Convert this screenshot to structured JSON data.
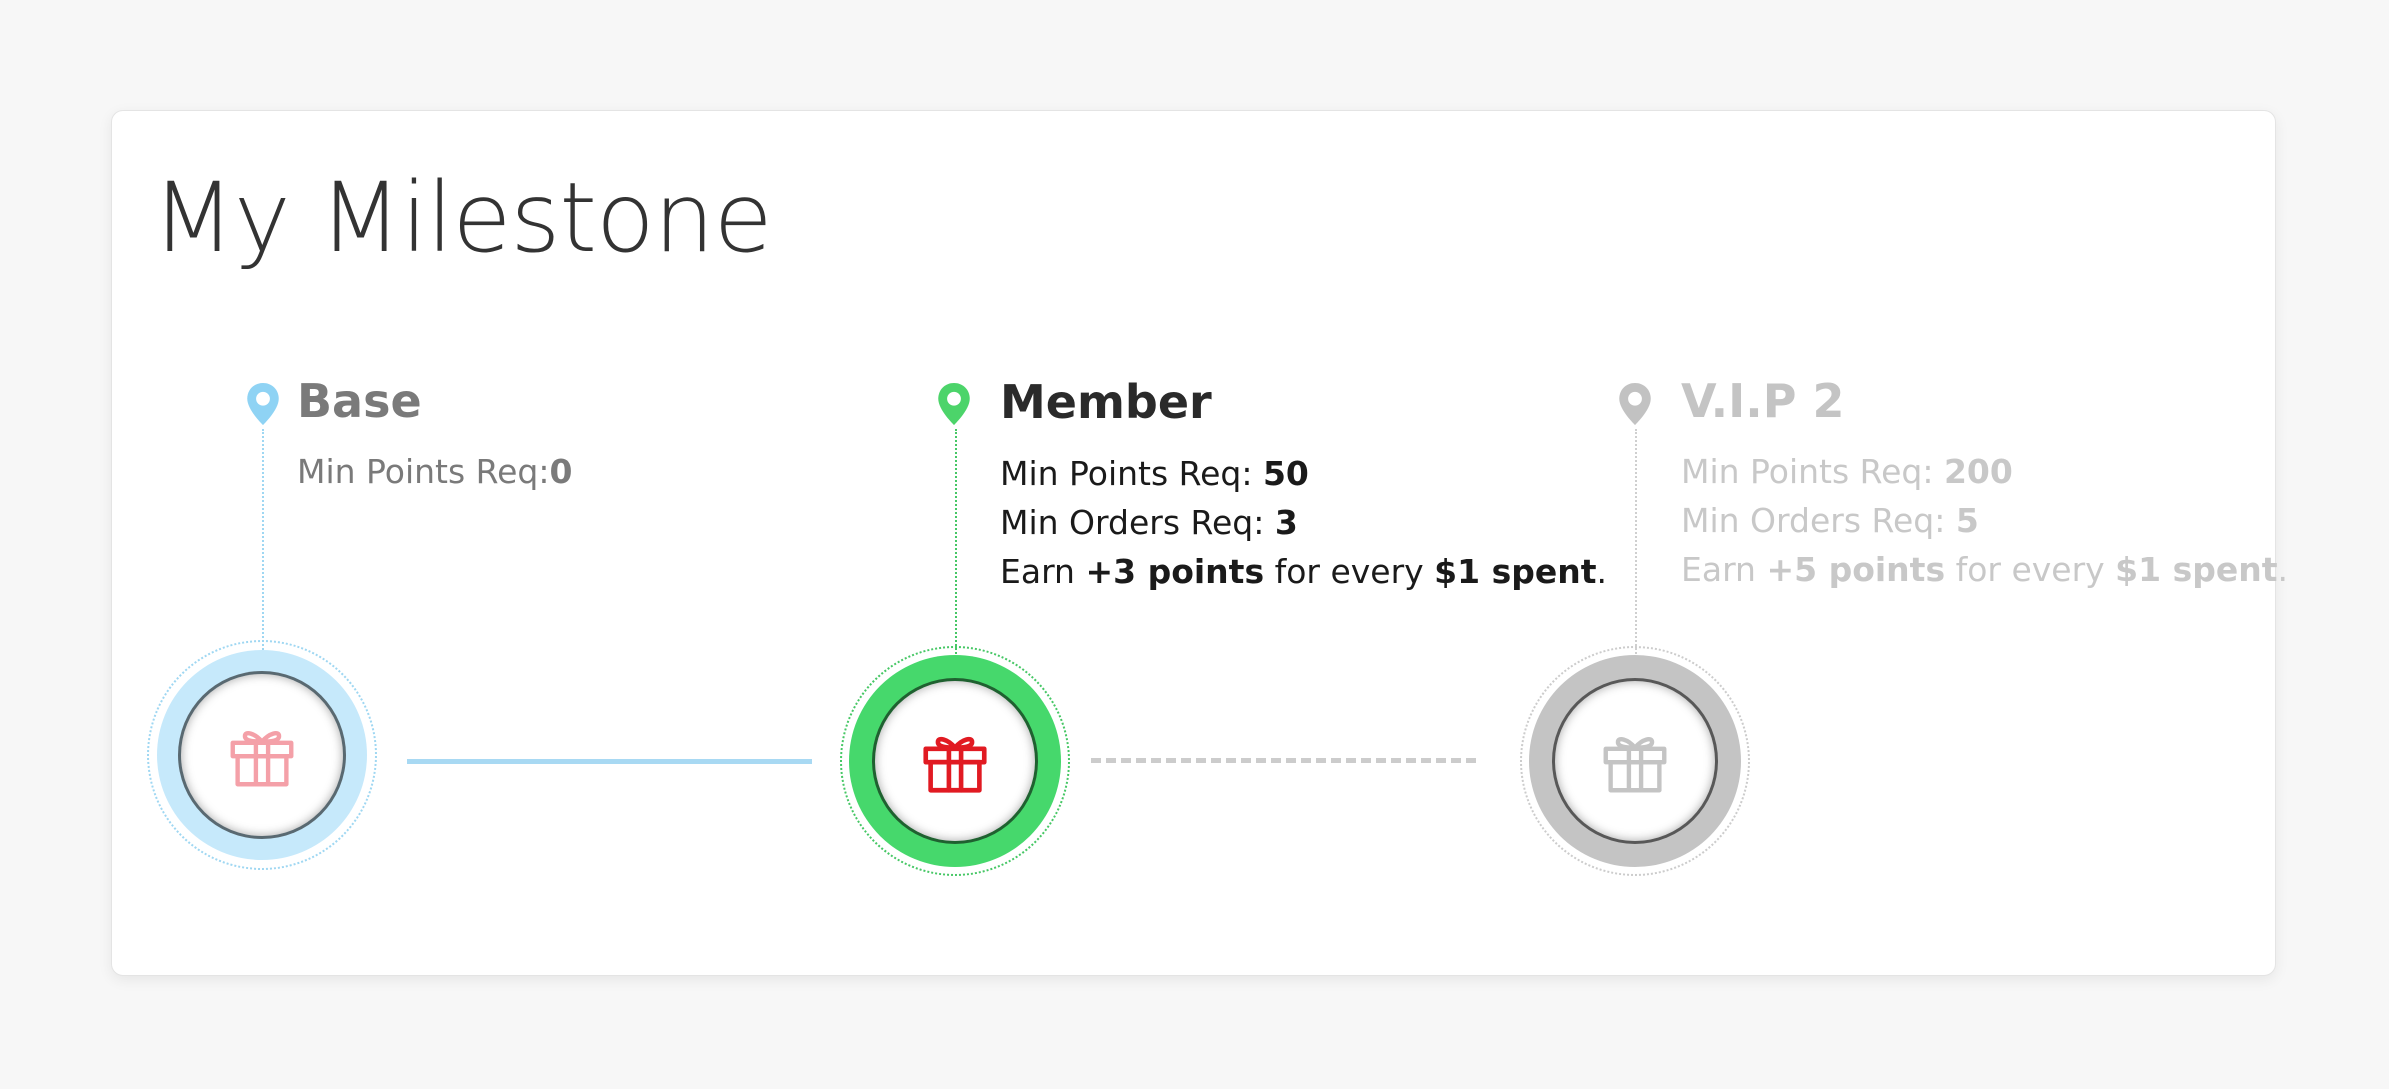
{
  "title": "My Milestone",
  "milestones": [
    {
      "name": "Base",
      "status": "achieved",
      "lines": [
        {
          "label": "Min Points Req:",
          "value": "0"
        }
      ],
      "colors": {
        "pin": "#8fd3f4",
        "ring": "#c6e9fb",
        "ring_dotted": "#9fd7f2",
        "gift": "#f4a0a8",
        "text": "#7a7a7a",
        "name": "#7a7a7a"
      }
    },
    {
      "name": "Member",
      "status": "current",
      "lines": [
        {
          "label": "Min Points Req: ",
          "value": "50"
        },
        {
          "label": "Min Orders Req: ",
          "value": "3"
        }
      ],
      "earn": {
        "prefix": "Earn ",
        "points": "+3 points",
        "middle": " for every ",
        "spent": "$1 spent",
        "suffix": "."
      },
      "colors": {
        "pin": "#4cd46a",
        "ring": "#46d86c",
        "ring_dotted": "#46c765",
        "gift": "#e11a22",
        "text": "#1a1a1a",
        "name": "#2a2a2a"
      }
    },
    {
      "name": "V.I.P 2",
      "status": "locked",
      "lines": [
        {
          "label": "Min Points Req: ",
          "value": "200"
        },
        {
          "label": "Min Orders Req: ",
          "value": "5"
        }
      ],
      "earn": {
        "prefix": "Earn ",
        "points": "+5 points",
        "middle": " for every ",
        "spent": "$1 spent",
        "suffix": "."
      },
      "colors": {
        "pin": "#c2c2c2",
        "ring": "#c4c4c4",
        "ring_dotted": "#c8c8c8",
        "gift": "#c4c4c4",
        "text": "#c8c8c8",
        "name": "#c4c4c4"
      }
    }
  ],
  "connectors": [
    {
      "style": "solid",
      "color": "#a8d9f3"
    },
    {
      "style": "dashed",
      "color": "#cccccc"
    }
  ]
}
